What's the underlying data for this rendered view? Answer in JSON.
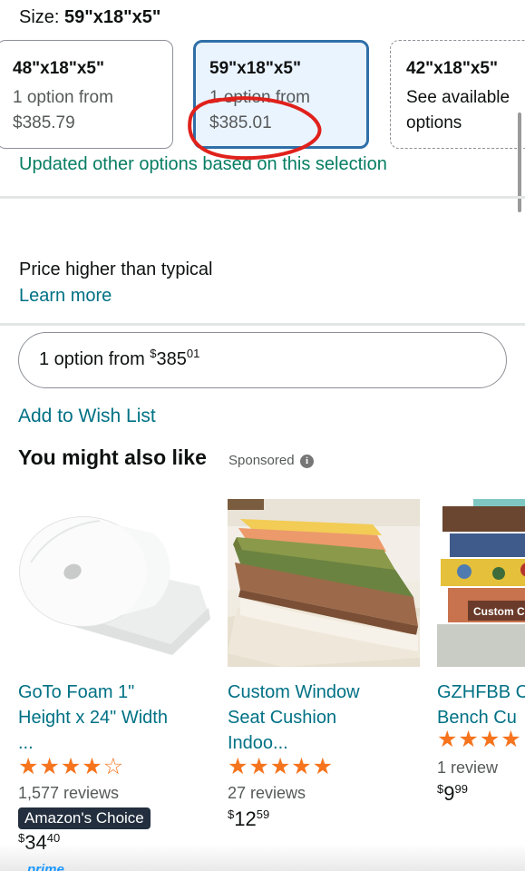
{
  "size": {
    "label": "Size: ",
    "value": "59\"x18\"x5\""
  },
  "options": [
    {
      "title": "48\"x18\"x5\"",
      "line1": "1 option from",
      "line2": "$385.79"
    },
    {
      "title": "59\"x18\"x5\"",
      "line1": "1 option from",
      "line2": "$385.01"
    },
    {
      "title": "42\"x18\"x5\"",
      "line1": "See available",
      "line2": "options"
    }
  ],
  "updated_text": "Updated other options based on this selection",
  "price_notice": {
    "text": "Price higher than typical",
    "link": "Learn more"
  },
  "option_button": {
    "prefix": "1 option from ",
    "currency": "$",
    "whole": "385",
    "cents": "01"
  },
  "wishlist_link": "Add to Wish List",
  "recommendations": {
    "heading": "You might also like",
    "sponsored": "Sponsored",
    "info_icon": "i",
    "products": [
      {
        "title_line1": "GoTo Foam 1\"",
        "title_line2": "Height x 24\" Width",
        "title_line3": "...",
        "rating": 4.5,
        "stars": "★★★★☆",
        "reviews": "1,577 reviews",
        "badge": "Amazon's Choice",
        "currency": "$",
        "price_whole": "34",
        "price_cents": "40"
      },
      {
        "title_line1": "Custom Window",
        "title_line2": "Seat Cushion",
        "title_line3": "Indoo...",
        "rating": 5,
        "stars": "★★★★★",
        "reviews": "27 reviews",
        "currency": "$",
        "price_whole": "12",
        "price_cents": "59"
      },
      {
        "title_line1": "GZHFBB C",
        "title_line2": "Bench Cu",
        "image_label": "Custom Co",
        "rating": 4,
        "stars": "★★★★",
        "reviews": "1 review",
        "currency": "$",
        "price_whole": "9",
        "price_cents": "99"
      }
    ]
  },
  "prime_label": "prime",
  "colors": {
    "link": "#007185",
    "success": "#067d62",
    "selected_border": "#2f6fa8",
    "star": "#f5741d",
    "annotation": "#e0211b"
  }
}
